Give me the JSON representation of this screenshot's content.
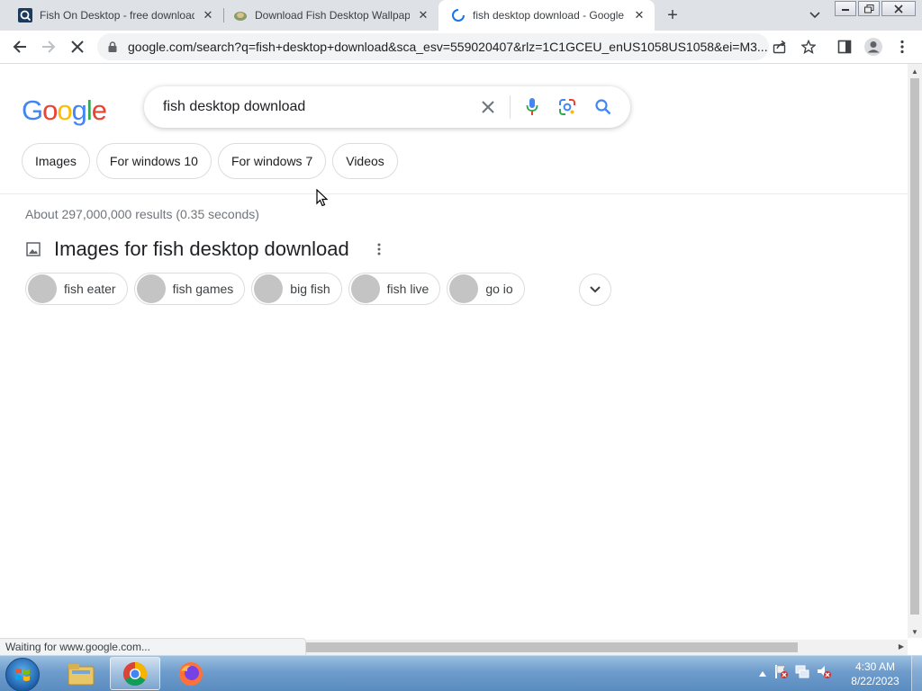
{
  "tabs": [
    {
      "title": "Fish On Desktop - free download",
      "icon": "magnifier-app-icon",
      "close": "✕"
    },
    {
      "title": "Download Fish Desktop Wallpaper",
      "icon": "fish-site-icon",
      "close": "✕"
    },
    {
      "title": "fish desktop download - Google Search",
      "icon": "loading-spinner-icon",
      "close": "✕",
      "active": true
    }
  ],
  "newtab_label": "+",
  "omnibox": {
    "url": "google.com/search?q=fish+desktop+download&sca_esv=559020407&rlz=1C1GCEU_enUS1058US1058&ei=M3..."
  },
  "google": {
    "logo_letters": [
      "G",
      "o",
      "o",
      "g",
      "l",
      "e"
    ],
    "logo_colors": [
      "#4285F4",
      "#EA4335",
      "#FBBC05",
      "#4285F4",
      "#34A853",
      "#EA4335"
    ],
    "query": "fish desktop download"
  },
  "filter_chips": [
    "Images",
    "For windows 10",
    "For windows 7",
    "Videos"
  ],
  "result_stats": "About 297,000,000 results (0.35 seconds)",
  "images_section": {
    "title": "Images for fish desktop download",
    "related": [
      "fish eater",
      "fish games",
      "big fish",
      "fish live",
      "go io"
    ]
  },
  "status_text": "Waiting for www.google.com...",
  "clock": {
    "time": "4:30 AM",
    "date": "8/22/2023"
  },
  "colors": {
    "accent": "#1a73e8",
    "tabstrip": "#dee1e6"
  }
}
